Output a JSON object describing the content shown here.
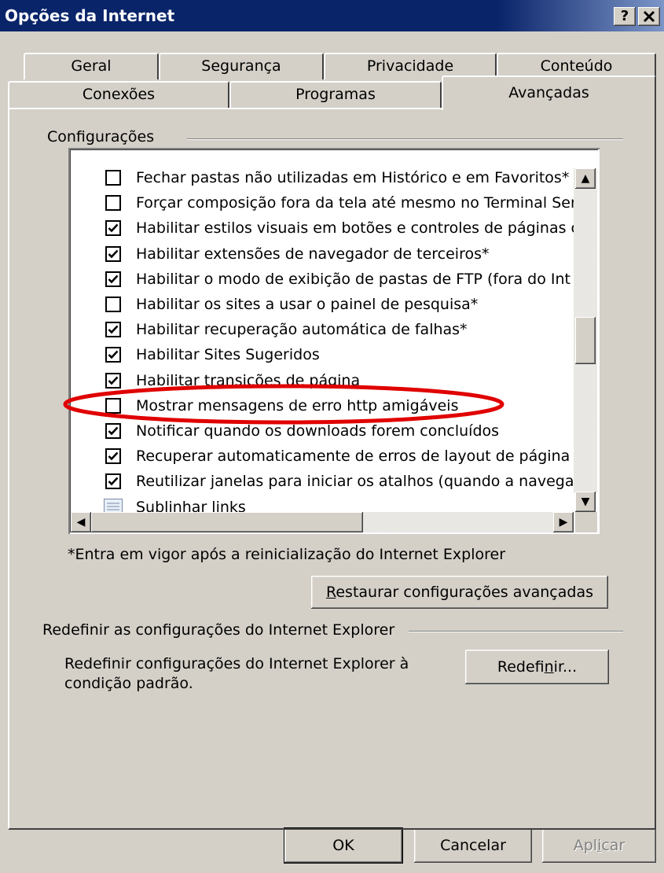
{
  "window": {
    "title": "Opções da Internet",
    "help_btn": "?",
    "close_btn": "✕"
  },
  "tabs": {
    "row1": [
      "Geral",
      "Segurança",
      "Privacidade",
      "Conteúdo"
    ],
    "row2": [
      "Conexões",
      "Programas",
      "Avançadas"
    ],
    "active": "Avançadas"
  },
  "settings": {
    "group_label": "Configurações",
    "items": [
      {
        "label": "Fechar pastas não utilizadas em Histórico e em Favoritos*",
        "checked": false
      },
      {
        "label": "Forçar composição fora da tela até mesmo no Terminal Ser",
        "checked": false
      },
      {
        "label": "Habilitar estilos visuais em botões e controles de páginas c",
        "checked": true
      },
      {
        "label": "Habilitar extensões de navegador de terceiros*",
        "checked": true
      },
      {
        "label": "Habilitar o modo de exibição de pastas de FTP (fora do Int",
        "checked": true
      },
      {
        "label": "Habilitar os sites a usar o painel de pesquisa*",
        "checked": false
      },
      {
        "label": "Habilitar recuperação automática de falhas*",
        "checked": true
      },
      {
        "label": "Habilitar Sites Sugeridos",
        "checked": true
      },
      {
        "label": "Habilitar transições de página",
        "checked": true
      },
      {
        "label": "Mostrar mensagens de erro http amigáveis",
        "checked": false
      },
      {
        "label": "Notificar quando os downloads forem concluídos",
        "checked": true
      },
      {
        "label": "Recuperar automaticamente de erros de layout de página",
        "checked": true
      },
      {
        "label": "Reutilizar janelas para iniciar os atalhos (quando a navega",
        "checked": true
      },
      {
        "label": "Sublinhar links",
        "checked": null
      }
    ],
    "note": "*Entra em vigor após a reinicialização do Internet Explorer",
    "restore_button": {
      "underlined": "R",
      "rest": "estaurar configurações avançadas"
    }
  },
  "reset": {
    "group_label": "Redefinir as configurações do Internet Explorer",
    "description_line1": "Redefinir configurações do Internet Explorer à",
    "description_line2": "condição padrão.",
    "button": {
      "before": "Redefi",
      "underlined": "n",
      "after": "ir..."
    }
  },
  "footer": {
    "ok": "OK",
    "cancel": "Cancelar",
    "apply": {
      "before": "Apl",
      "underlined": "i",
      "after": "car"
    }
  },
  "scrollbar": {
    "up": "▲",
    "down": "▼",
    "left": "◀",
    "right": "▶"
  },
  "colors": {
    "title_bar": "#0a246a",
    "dialog_face": "#d4d0c8",
    "annotation_ellipse": "#e00000"
  }
}
